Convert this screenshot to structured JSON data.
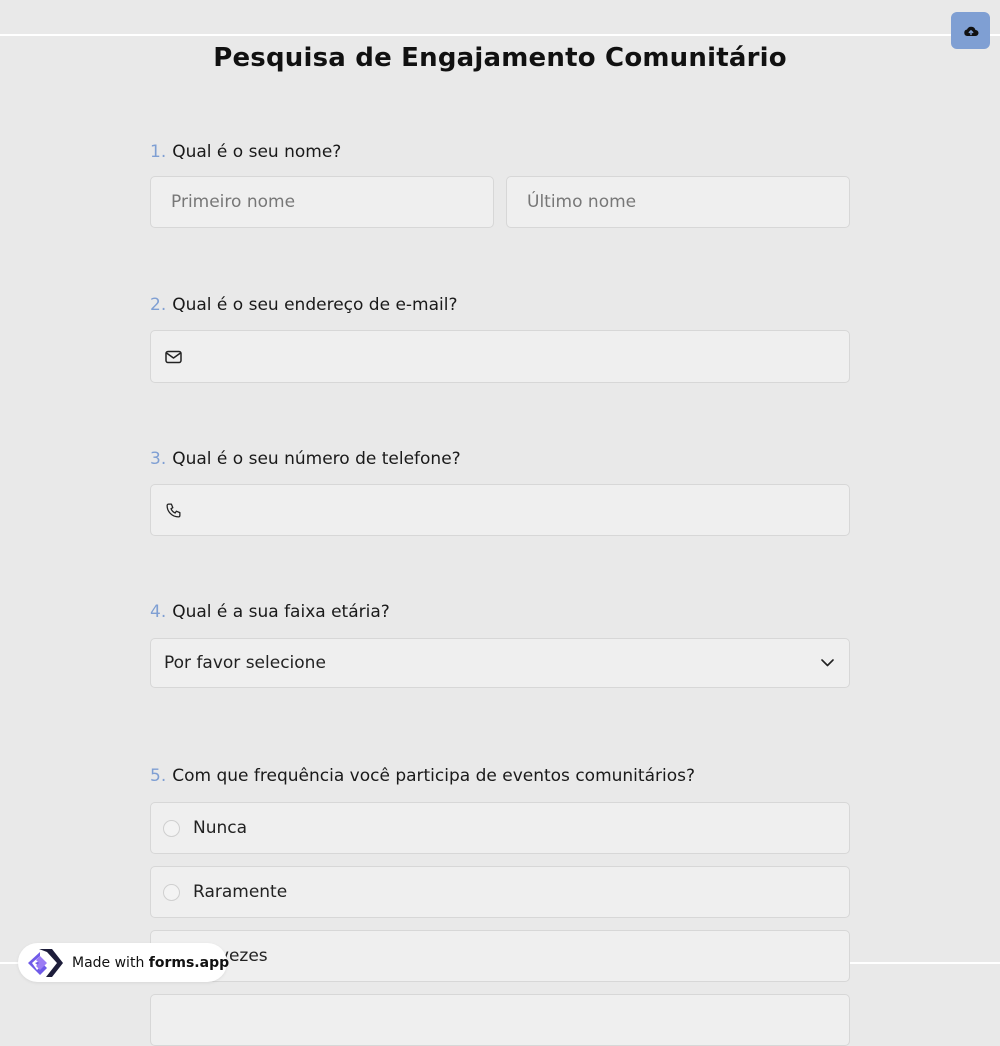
{
  "form": {
    "title": "Pesquisa de Engajamento Comunitário",
    "questions": [
      {
        "number": "1.",
        "label": "Qual é o seu nome?",
        "first_placeholder": "Primeiro nome",
        "last_placeholder": "Último nome"
      },
      {
        "number": "2.",
        "label": "Qual é o seu endereço de e-mail?",
        "icon": "mail-icon"
      },
      {
        "number": "3.",
        "label": "Qual é o seu número de telefone?",
        "icon": "phone-icon"
      },
      {
        "number": "4.",
        "label": "Qual é a sua faixa etária?",
        "selected": "Por favor selecione",
        "icon": "chevron-down-icon"
      },
      {
        "number": "5.",
        "label": "Com que frequência você participa de eventos comunitários?",
        "options": [
          "Nunca",
          "Raramente",
          "Às vezes"
        ]
      }
    ]
  },
  "toolbar": {
    "upload_icon": "cloud-upload-icon"
  },
  "badge": {
    "prefix": "Made with",
    "brand": "forms.app"
  },
  "colors": {
    "accent": "#7f9fd3",
    "background": "#e9e9e9",
    "field": "#efefef"
  }
}
